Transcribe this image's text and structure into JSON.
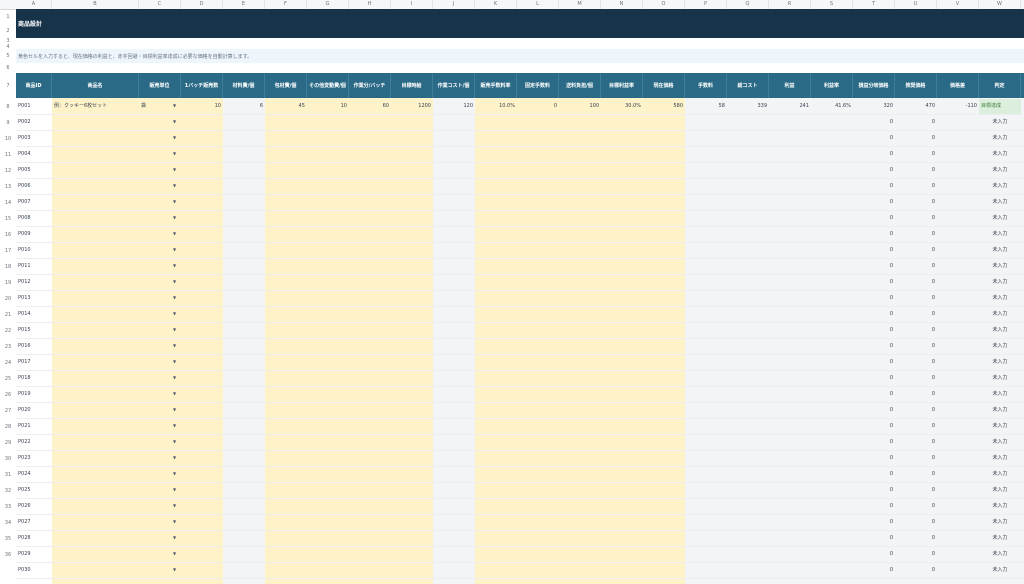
{
  "columns": [
    "A",
    "B",
    "C",
    "D",
    "E",
    "F",
    "G",
    "H",
    "I",
    "J",
    "K",
    "L",
    "M",
    "N",
    "O",
    "P",
    "Q",
    "R",
    "S",
    "T",
    "U",
    "V",
    "W"
  ],
  "title": "商品設計",
  "note": "黄色セルを入力すると、現在価格の利益と、赤字回避・目標利益率達成に必要な価格を自動計算します。",
  "headers": [
    "商品ID",
    "商品名",
    "販売単位",
    "1バッチ販売数",
    "材料費/個",
    "包材費/個",
    "その他変動費/個",
    "作業分/バッチ",
    "目標時給",
    "作業コスト/個",
    "販売手数料率",
    "固定手数料",
    "送料負担/個",
    "目標利益率",
    "現在価格",
    "手数料",
    "総コスト",
    "利益",
    "利益率",
    "損益分岐価格",
    "推奨価格",
    "価格差",
    "判定"
  ],
  "row_numbers": [
    "1",
    "2",
    "3",
    "4",
    "5",
    "6",
    "7",
    "8",
    "9",
    "10",
    "11",
    "12",
    "13",
    "14",
    "15",
    "16",
    "17",
    "18",
    "19",
    "20",
    "21",
    "22",
    "23",
    "24",
    "25",
    "26",
    "27",
    "28",
    "29",
    "30",
    "31",
    "32",
    "33",
    "34",
    "35",
    "36"
  ],
  "first_row": {
    "id": "P001",
    "name": "例：クッキー6枚セット",
    "unit": "袋",
    "batch": "10",
    "material": "6",
    "packaging": "45",
    "other": "10",
    "minutes": "60",
    "wage": "1200",
    "labor": "120",
    "fee_rate": "10.0%",
    "fixed_fee": "0",
    "shipping": "100",
    "target_margin": "30.0%",
    "price": "580",
    "fee": "58",
    "total_cost": "339",
    "profit": "241",
    "margin": "41.6%",
    "breakeven": "320",
    "recommended": "470",
    "diff": "-110",
    "verdict": "目標達成"
  },
  "empty_rows": {
    "ids": [
      "P002",
      "P003",
      "P004",
      "P005",
      "P006",
      "P007",
      "P008",
      "P009",
      "P010",
      "P011",
      "P012",
      "P013",
      "P014",
      "P015",
      "P016",
      "P017",
      "P018",
      "P019",
      "P020",
      "P021",
      "P022",
      "P023",
      "P024",
      "P025",
      "P026",
      "P027",
      "P028",
      "P029",
      "P030"
    ],
    "zero": "0",
    "verdict": "未入力",
    "dropdown_glyph": "▼"
  }
}
